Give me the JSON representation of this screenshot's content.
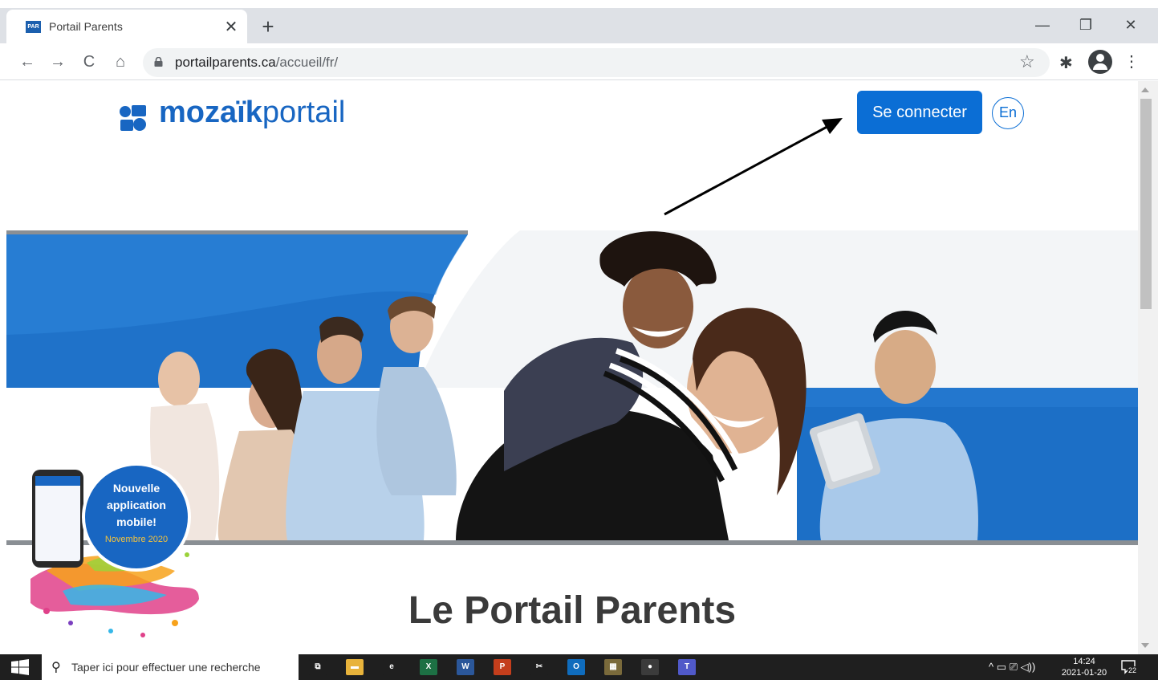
{
  "browser": {
    "tab_title": "Portail Parents",
    "favicon_text": "PAR",
    "tab_close": "✕",
    "new_tab": "+",
    "window_controls": {
      "minimize": "—",
      "maximize": "❐",
      "close": "✕"
    },
    "nav": {
      "back": "←",
      "forward": "→",
      "reload": "C",
      "home": "⌂"
    },
    "url_domain": "portailparents.ca",
    "url_path": "/accueil/fr/",
    "bookmark_icon": "☆",
    "extensions_icon": "✱",
    "menu_icon": "⋮"
  },
  "page": {
    "logo": {
      "bold": "mozaïk",
      "light": "portail"
    },
    "login_button": "Se connecter",
    "language_button": "En",
    "badge": {
      "line1": "Nouvelle",
      "line2": "application",
      "line3": "mobile!",
      "line4": "Novembre 2020"
    },
    "title": "Le Portail Parents"
  },
  "taskbar": {
    "search_icon": "⚲",
    "search_placeholder": "Taper ici pour effectuer une recherche",
    "apps": [
      {
        "name": "task-view",
        "label": "⧉",
        "color": "#1f1f1f"
      },
      {
        "name": "file-explorer",
        "label": "▬",
        "color": "#e8b33b"
      },
      {
        "name": "edge",
        "label": "e",
        "color": "#1f1f1f"
      },
      {
        "name": "excel",
        "label": "X",
        "color": "#1d7044"
      },
      {
        "name": "word",
        "label": "W",
        "color": "#2b579a"
      },
      {
        "name": "powerpoint",
        "label": "P",
        "color": "#c43e1c"
      },
      {
        "name": "snipping",
        "label": "✂",
        "color": "#1f1f1f"
      },
      {
        "name": "outlook",
        "label": "O",
        "color": "#0f6cbd"
      },
      {
        "name": "photos",
        "label": "▦",
        "color": "#7a6a3b"
      },
      {
        "name": "chrome",
        "label": "●",
        "color": "#3b3b3b"
      },
      {
        "name": "teams",
        "label": "T",
        "color": "#5059c9"
      }
    ],
    "tray": "^ ▭ ⎚ ◁))",
    "time": "14:24",
    "date": "2021-01-20",
    "notifications": "22"
  },
  "colors": {
    "brand": "#1866c2",
    "button": "#0b6ed5"
  }
}
